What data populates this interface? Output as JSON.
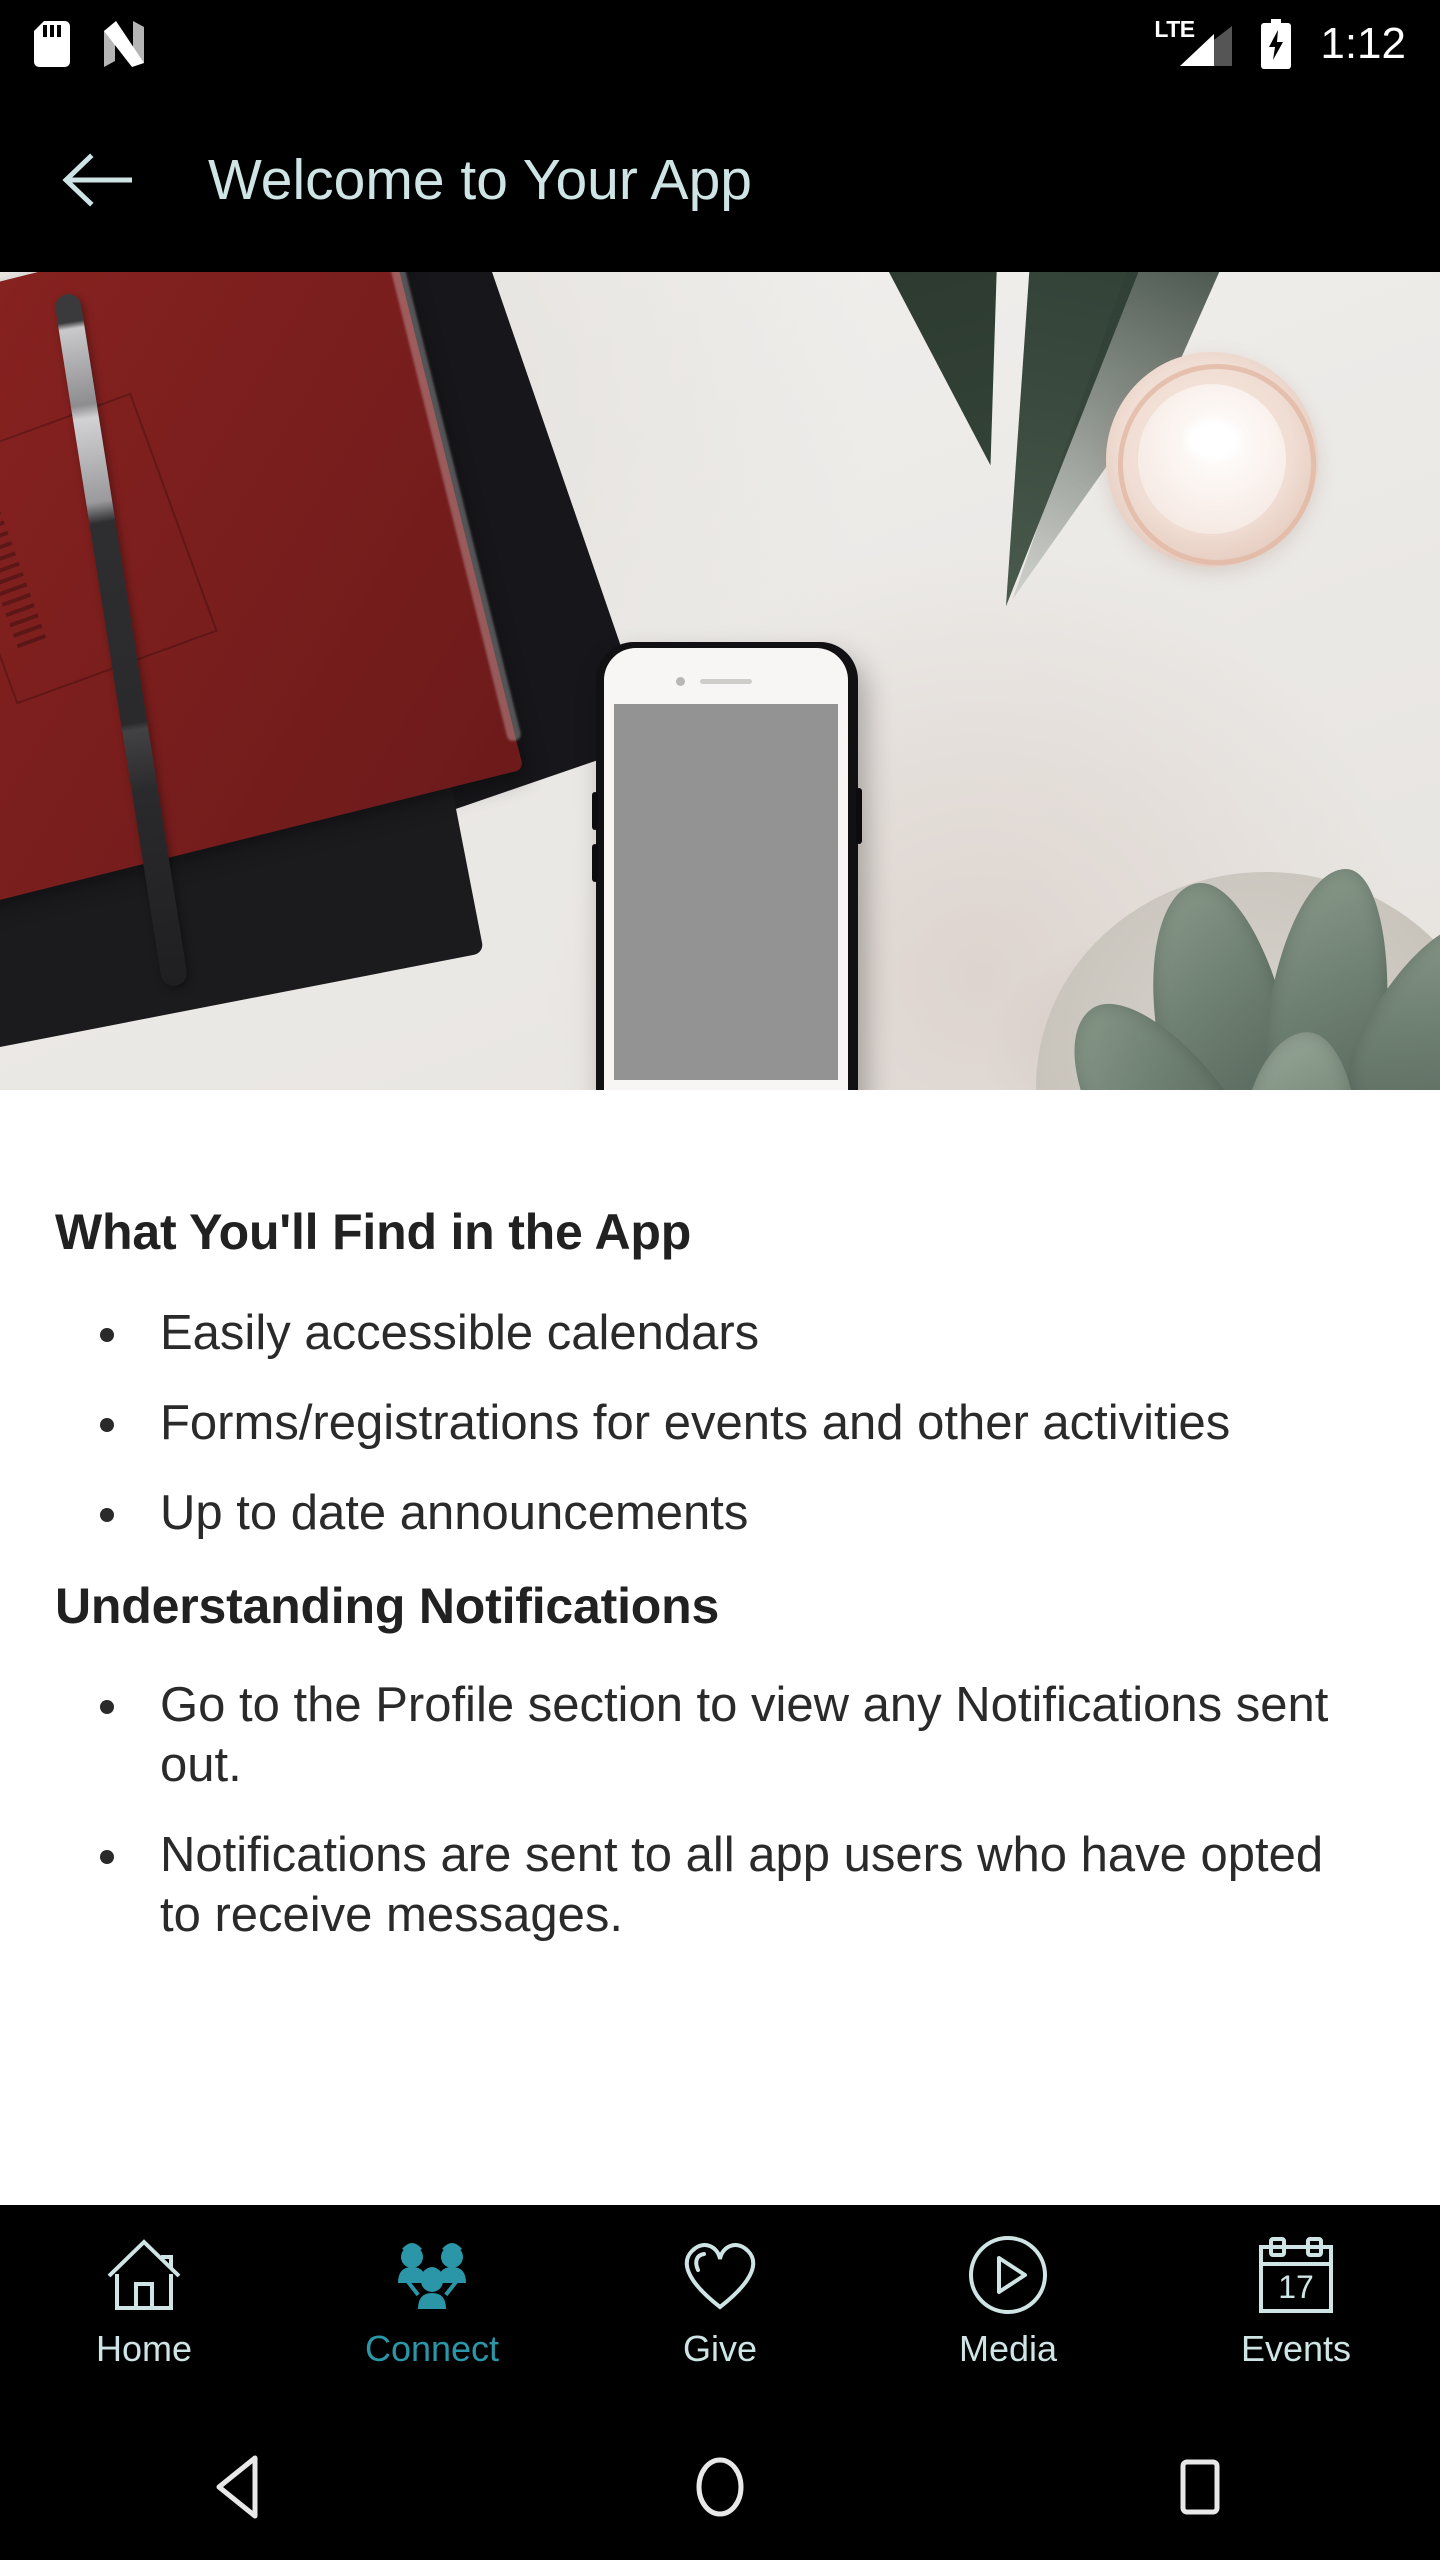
{
  "status_bar": {
    "icons_left": [
      "sdcard-icon",
      "android-nougat-icon"
    ],
    "network_label": "LTE",
    "battery": "charging",
    "time": "1:12"
  },
  "app_bar": {
    "back_icon": "arrow-left-icon",
    "title": "Welcome to Your App",
    "title_color": "#cfe5e5",
    "background_color": "#000000"
  },
  "hero": {
    "alt": "Flat lay photo of a red notebook with pen, white smartphone, glass candle and succulent plant on a white desk",
    "phone_screen_color": "#939393"
  },
  "content": {
    "sections": [
      {
        "heading": "What You'll Find in the App",
        "bullets": [
          "Easily accessible calendars",
          "Forms/registrations for events and other activities",
          "Up to date announcements"
        ]
      },
      {
        "heading": "Understanding Notifications",
        "bullets": [
          "Go to the Profile section to view any Notifications sent out.",
          "Notifications are sent to all app users who have opted to receive messages."
        ]
      }
    ]
  },
  "bottom_nav": {
    "active_index": 1,
    "active_color": "#2a96a8",
    "inactive_color": "#cfe5e5",
    "items": [
      {
        "label": "Home",
        "icon": "home-icon"
      },
      {
        "label": "Connect",
        "icon": "people-group-icon"
      },
      {
        "label": "Give",
        "icon": "heart-icon"
      },
      {
        "label": "Media",
        "icon": "play-circle-icon"
      },
      {
        "label": "Events",
        "icon": "calendar-icon",
        "calendar_day": "17"
      }
    ]
  },
  "system_nav": {
    "buttons": [
      {
        "name": "back",
        "icon": "triangle-back-icon"
      },
      {
        "name": "home",
        "icon": "circle-home-icon"
      },
      {
        "name": "recents",
        "icon": "square-recents-icon"
      }
    ]
  }
}
